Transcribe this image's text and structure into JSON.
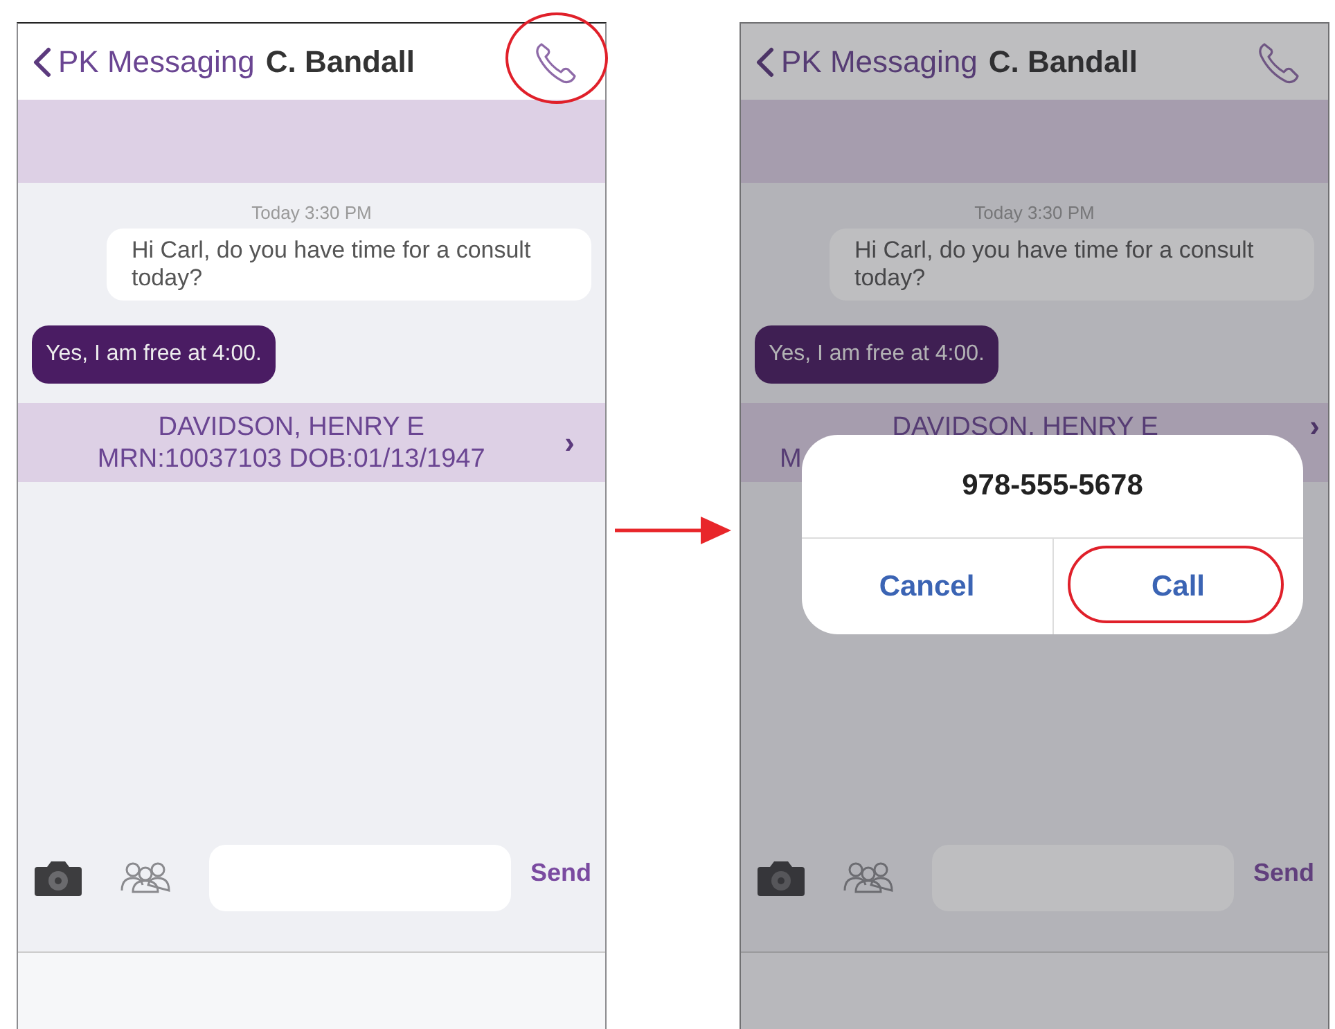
{
  "screens": [
    {
      "dimmed": false,
      "header": {
        "back_label": "PK Messaging",
        "contact": "C. Bandall",
        "call_highlighted": true
      },
      "timestamp": "Today 3:30 PM",
      "messages": [
        {
          "text": "Hi Carl, do you have time for a consult today?",
          "kind": "incoming"
        },
        {
          "text": "Yes, I am free at 4:00.",
          "kind": "outgoing"
        }
      ],
      "patient": {
        "name": "DAVIDSON, HENRY E",
        "details": "MRN:10037103 DOB:01/13/1947",
        "covered": false,
        "chevron": "›"
      },
      "composer": {
        "send": "Send"
      }
    },
    {
      "dimmed": true,
      "header": {
        "back_label": "PK Messaging",
        "contact": "C. Bandall",
        "call_highlighted": false
      },
      "timestamp": "Today 3:30 PM",
      "messages": [
        {
          "text": "Hi Carl, do you have time for a consult today?",
          "kind": "incoming"
        },
        {
          "text": "Yes, I am free at 4:00.",
          "kind": "outgoing"
        }
      ],
      "patient": {
        "name": "DAVIDSON, HENRY E",
        "details": "M",
        "covered": true,
        "chevron": "›"
      },
      "composer": {
        "send": "Send"
      },
      "dialog": {
        "number": "978-555-5678",
        "buttons": [
          {
            "label": "Cancel",
            "highlighted": false
          },
          {
            "label": "Call",
            "highlighted": true
          }
        ]
      }
    }
  ]
}
